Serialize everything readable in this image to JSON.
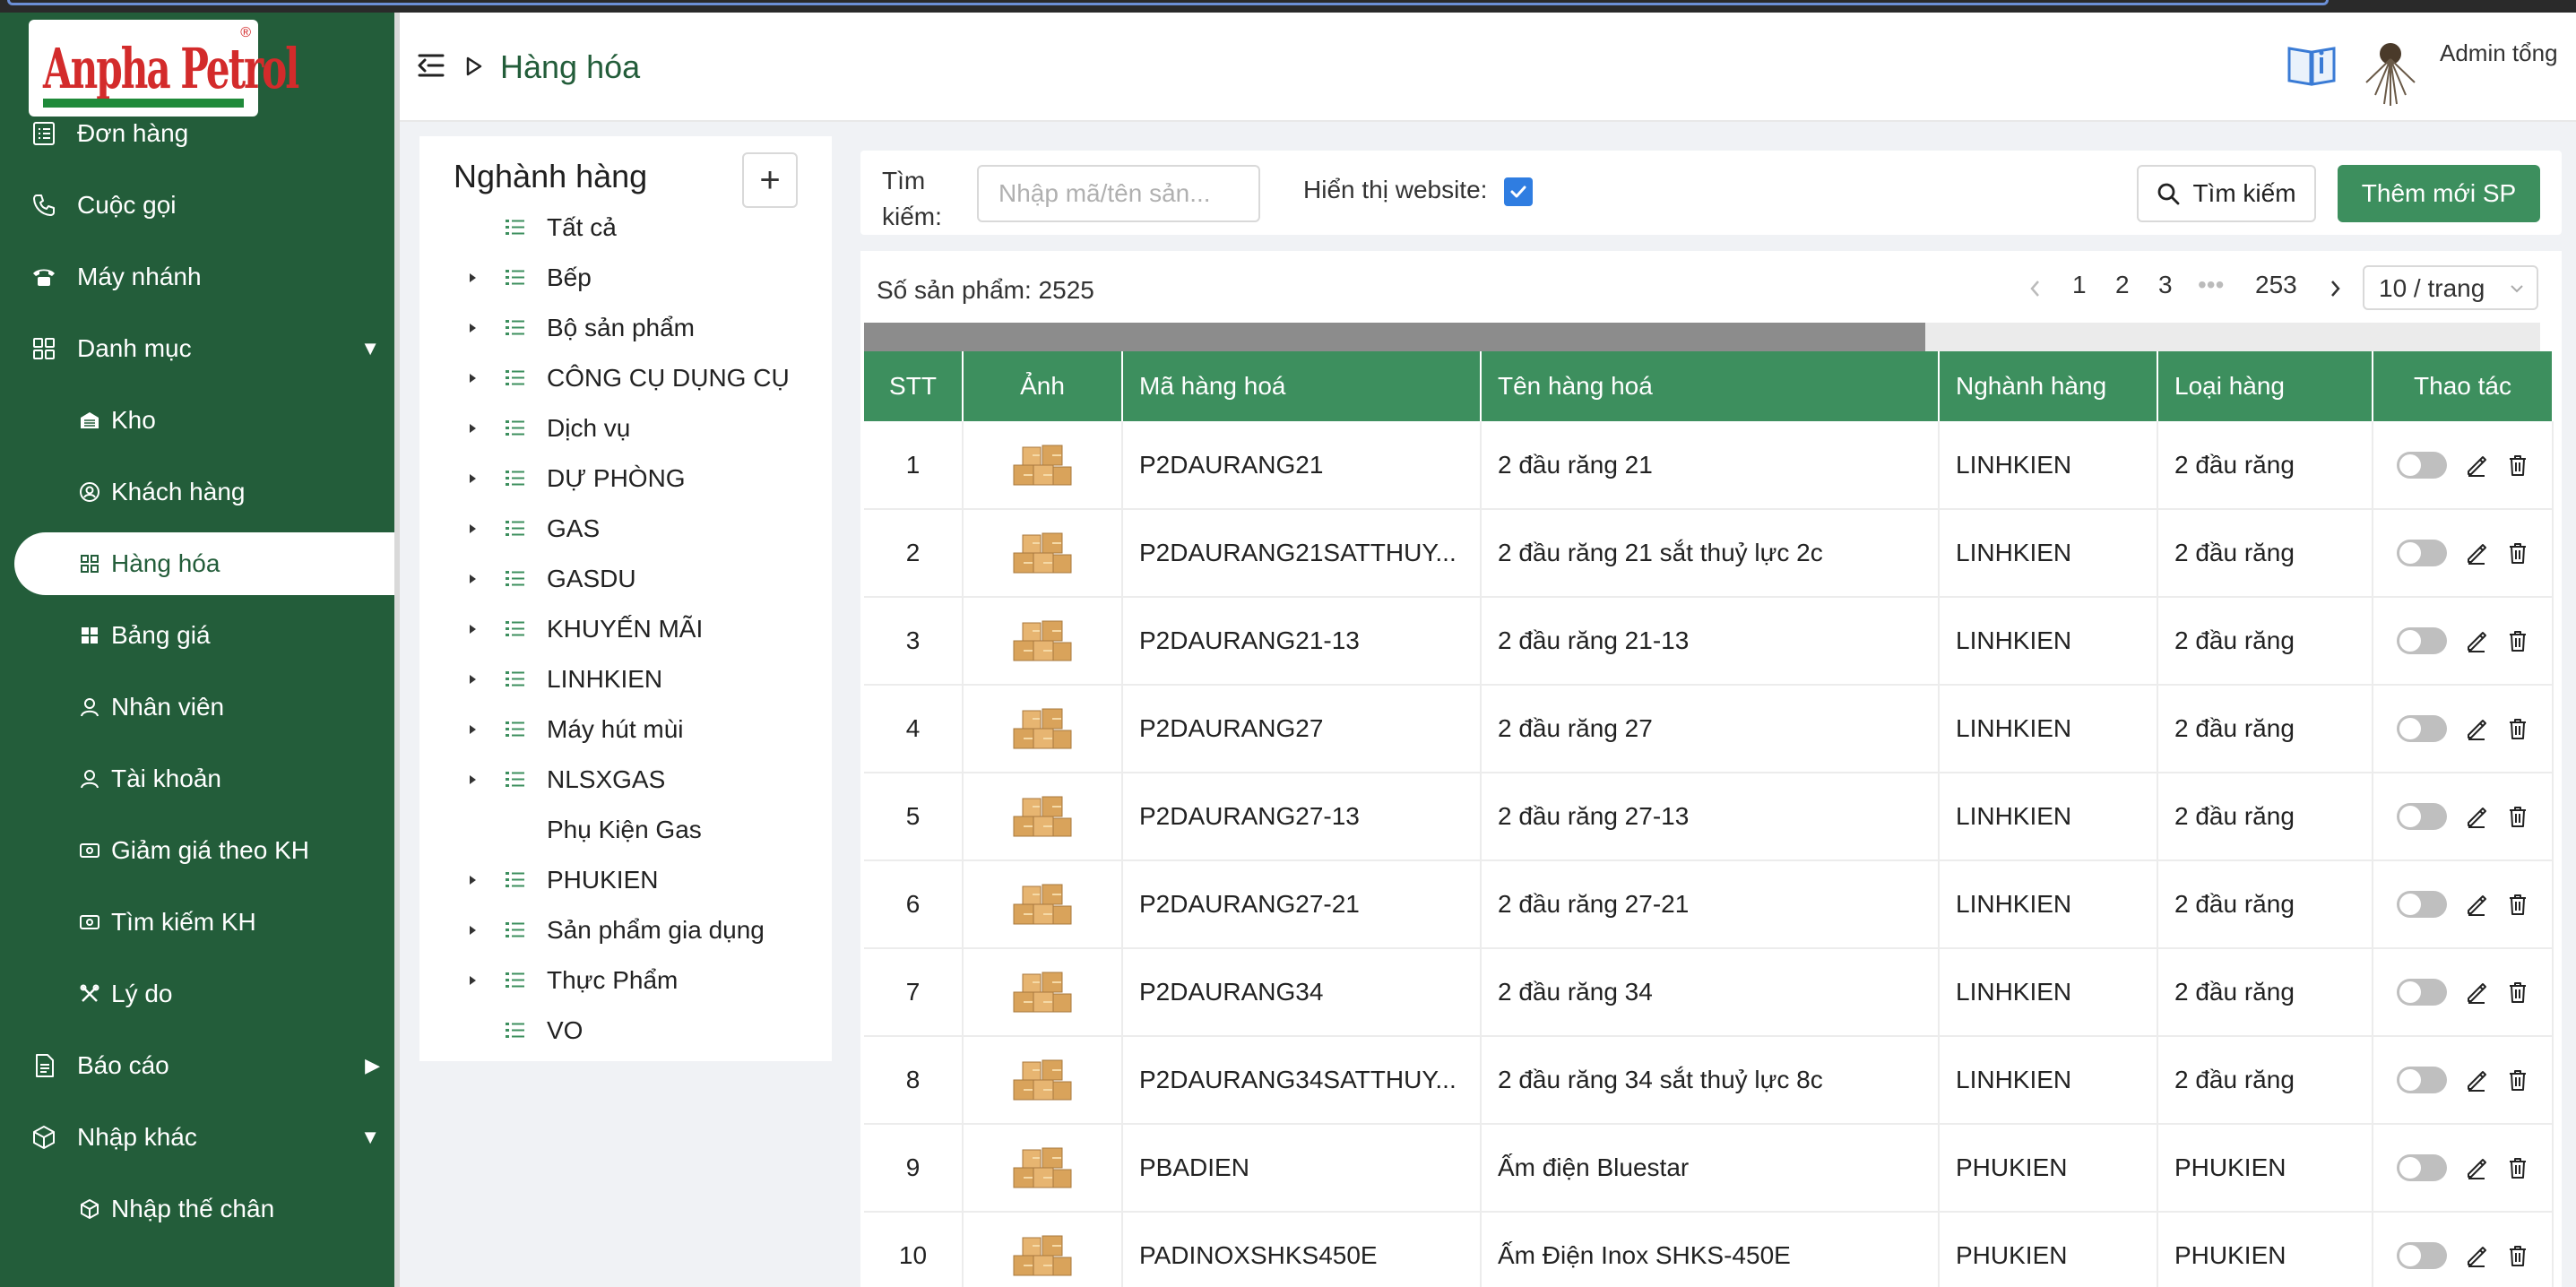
{
  "brand": {
    "logo_text": "Anpha Petrol",
    "reg_mark": "®"
  },
  "sidebar": {
    "items": [
      {
        "label": "Đơn hàng",
        "icon": "list-icon"
      },
      {
        "label": "Cuộc gọi",
        "icon": "phone-icon"
      },
      {
        "label": "Máy nhánh",
        "icon": "telephone-icon"
      },
      {
        "label": "Danh mục",
        "icon": "grid-icon",
        "caret": "▼"
      },
      {
        "label": "Kho",
        "icon": "warehouse-icon"
      },
      {
        "label": "Khách hàng",
        "icon": "user-circle-icon"
      },
      {
        "label": "Hàng hóa",
        "icon": "grid-small-icon"
      },
      {
        "label": "Bảng giá",
        "icon": "grid-filled-icon"
      },
      {
        "label": "Nhân viên",
        "icon": "user-icon"
      },
      {
        "label": "Tài khoản",
        "icon": "user-icon"
      },
      {
        "label": "Giảm giá theo KH",
        "icon": "money-icon"
      },
      {
        "label": "Tìm kiếm KH",
        "icon": "money-icon"
      },
      {
        "label": "Lý do",
        "icon": "tools-icon"
      },
      {
        "label": "Báo cáo",
        "icon": "document-icon",
        "caret": "▶"
      },
      {
        "label": "Nhập khác",
        "icon": "box-check-icon",
        "caret": "▼"
      },
      {
        "label": "Nhập thế chân",
        "icon": "box-icon"
      }
    ]
  },
  "header": {
    "title": "Hàng hóa",
    "user_name": "Admin tổng"
  },
  "categories": {
    "title": "Nghành hàng",
    "add_label": "+",
    "items": [
      {
        "label": "Tất cả",
        "expandable": false
      },
      {
        "label": "Bếp",
        "expandable": true
      },
      {
        "label": "Bộ sản phẩm",
        "expandable": true
      },
      {
        "label": "CÔNG CỤ DỤNG CỤ",
        "expandable": true
      },
      {
        "label": "Dịch vụ",
        "expandable": true
      },
      {
        "label": "DỰ PHÒNG",
        "expandable": true
      },
      {
        "label": "GAS",
        "expandable": true
      },
      {
        "label": "GASDU",
        "expandable": true
      },
      {
        "label": "KHUYẾN MÃI",
        "expandable": true
      },
      {
        "label": "LINHKIEN",
        "expandable": true
      },
      {
        "label": "Máy hút mùi",
        "expandable": true
      },
      {
        "label": "NLSXGAS",
        "expandable": true
      },
      {
        "label": "Phụ Kiện Gas",
        "expandable": false
      },
      {
        "label": "PHUKIEN",
        "expandable": true
      },
      {
        "label": "Sản phẩm gia dụng",
        "expandable": true
      },
      {
        "label": "Thực Phẩm",
        "expandable": true
      },
      {
        "label": "VO",
        "expandable": false
      }
    ]
  },
  "search": {
    "label_line1": "Tìm",
    "label_line2": "kiếm:",
    "placeholder": "Nhập mã/tên sản...",
    "website_label": "Hiển thị website:",
    "website_checked": true,
    "search_button": "Tìm kiếm",
    "add_button": "Thêm mới SP"
  },
  "pagination": {
    "count_label": "Số sản phẩm: 2525",
    "pages": [
      "1",
      "2",
      "3",
      "•••",
      "253"
    ],
    "page_size": "10 / trang"
  },
  "table": {
    "columns": [
      "STT",
      "Ảnh",
      "Mã hàng hoá",
      "Tên hàng hoá",
      "Nghành hàng",
      "Loại hàng",
      "Thao tác"
    ],
    "rows": [
      {
        "stt": "1",
        "code": "P2DAURANG21",
        "name": "2 đầu răng 21",
        "category": "LINHKIEN",
        "type": "2 đầu răng"
      },
      {
        "stt": "2",
        "code": "P2DAURANG21SATTHUY...",
        "name": "2 đầu răng 21 sắt thuỷ lực 2c",
        "category": "LINHKIEN",
        "type": "2 đầu răng"
      },
      {
        "stt": "3",
        "code": "P2DAURANG21-13",
        "name": "2 đầu răng 21-13",
        "category": "LINHKIEN",
        "type": "2 đầu răng"
      },
      {
        "stt": "4",
        "code": "P2DAURANG27",
        "name": "2 đầu răng 27",
        "category": "LINHKIEN",
        "type": "2 đầu răng"
      },
      {
        "stt": "5",
        "code": "P2DAURANG27-13",
        "name": "2 đầu răng 27-13",
        "category": "LINHKIEN",
        "type": "2 đầu răng"
      },
      {
        "stt": "6",
        "code": "P2DAURANG27-21",
        "name": "2 đầu răng 27-21",
        "category": "LINHKIEN",
        "type": "2 đầu răng"
      },
      {
        "stt": "7",
        "code": "P2DAURANG34",
        "name": "2 đầu răng 34",
        "category": "LINHKIEN",
        "type": "2 đầu răng"
      },
      {
        "stt": "8",
        "code": "P2DAURANG34SATTHUY...",
        "name": "2 đầu răng 34 sắt thuỷ lực 8c",
        "category": "LINHKIEN",
        "type": "2 đầu răng"
      },
      {
        "stt": "9",
        "code": "PBADIEN",
        "name": "Ấm điện Bluestar",
        "category": "PHUKIEN",
        "type": "PHUKIEN"
      },
      {
        "stt": "10",
        "code": "PADINOXSHKS450E",
        "name": "Ấm Điện Inox SHKS-450E",
        "category": "PHUKIEN",
        "type": "PHUKIEN"
      }
    ]
  },
  "colors": {
    "sidebar": "#235d3a",
    "accent": "#3d8f5e",
    "check": "#2f7de1"
  }
}
